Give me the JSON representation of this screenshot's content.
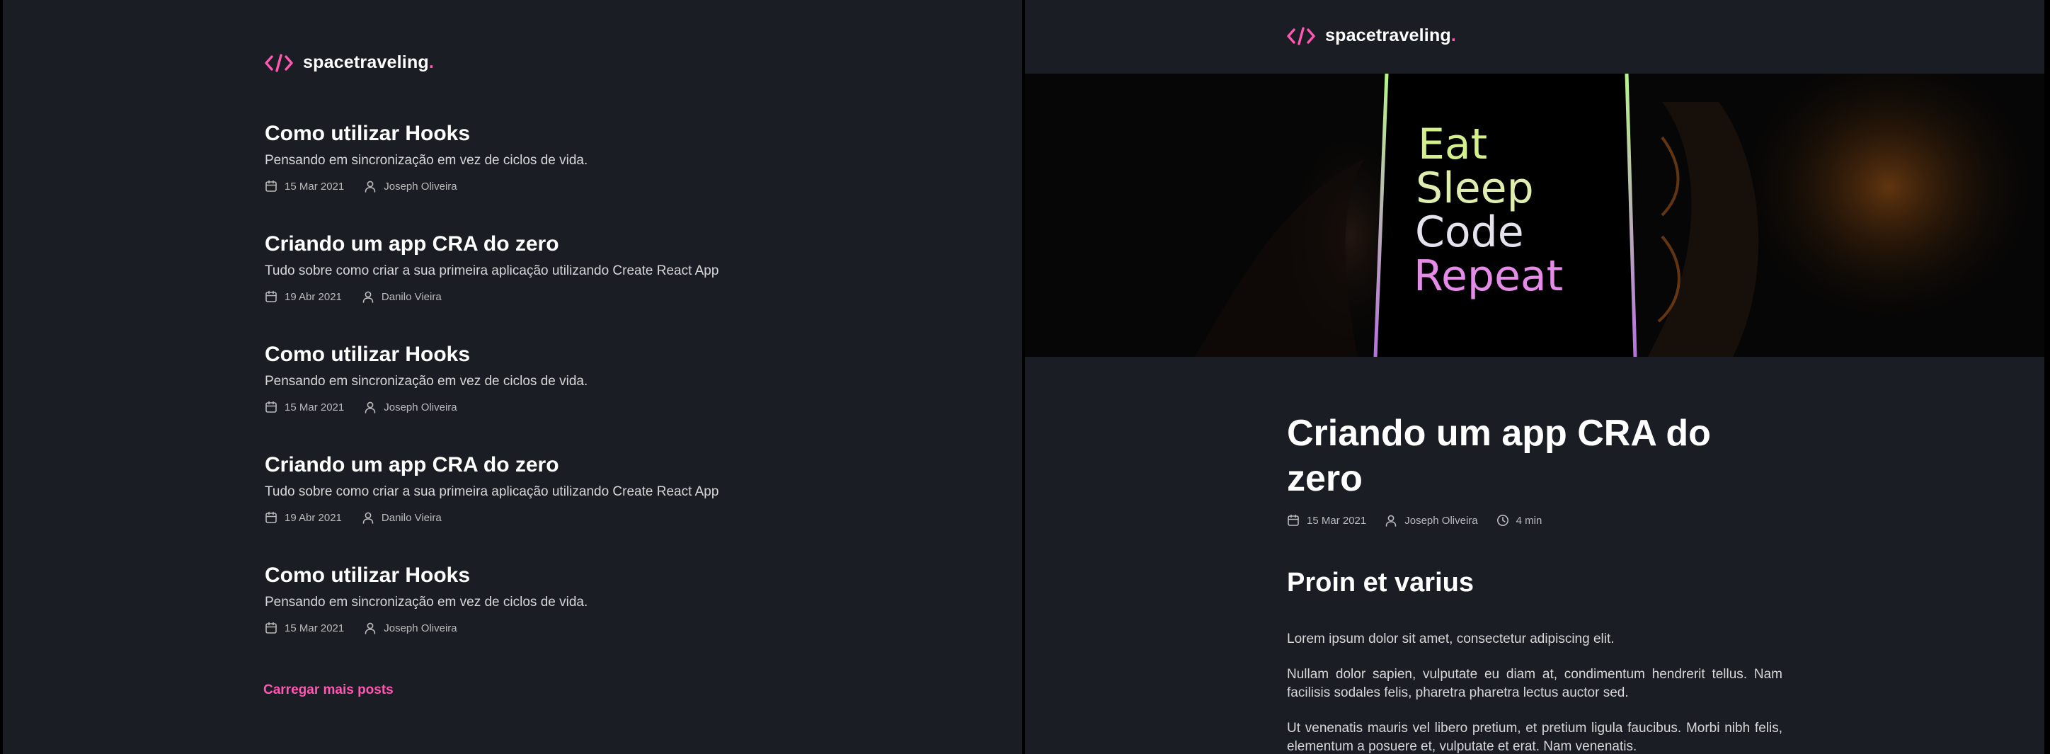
{
  "brand": {
    "name": "spacetraveling",
    "dot": ".",
    "accent_color": "#ff57b2",
    "icon": "code-brackets-icon"
  },
  "home": {
    "posts": [
      {
        "title": "Como utilizar Hooks",
        "subtitle": "Pensando em sincronização em vez de ciclos de vida.",
        "date": "15 Mar 2021",
        "author": "Joseph Oliveira"
      },
      {
        "title": "Criando um app CRA do zero",
        "subtitle": "Tudo sobre como criar a sua primeira aplicação utilizando Create React App",
        "date": "19 Abr 2021",
        "author": "Danilo Vieira"
      },
      {
        "title": "Como utilizar Hooks",
        "subtitle": "Pensando em sincronização em vez de ciclos de vida.",
        "date": "15 Mar 2021",
        "author": "Joseph Oliveira"
      },
      {
        "title": "Criando um app CRA do zero",
        "subtitle": "Tudo sobre como criar a sua primeira aplicação utilizando Create React App",
        "date": "19 Abr 2021",
        "author": "Danilo Vieira"
      },
      {
        "title": "Como utilizar Hooks",
        "subtitle": "Pensando em sincronização em vez de ciclos de vida.",
        "date": "15 Mar 2021",
        "author": "Joseph Oliveira"
      }
    ],
    "load_more_label": "Carregar mais posts"
  },
  "post_page": {
    "banner_text": [
      "Eat",
      "Sleep",
      "Code",
      "Repeat"
    ],
    "title": "Criando um app CRA do zero",
    "date": "15 Mar 2021",
    "author": "Joseph Oliveira",
    "reading_time": "4 min",
    "section_heading": "Proin et varius",
    "paragraphs": [
      "Lorem ipsum dolor sit amet, consectetur adipiscing elit.",
      "Nullam dolor sapien, vulputate eu diam at, condimentum hendrerit tellus. Nam facilisis sodales felis, pharetra pharetra lectus auctor sed.",
      "Ut venenatis mauris vel libero pretium, et pretium ligula faucibus. Morbi nibh felis, elementum a posuere et, vulputate et erat. Nam venenatis."
    ]
  }
}
